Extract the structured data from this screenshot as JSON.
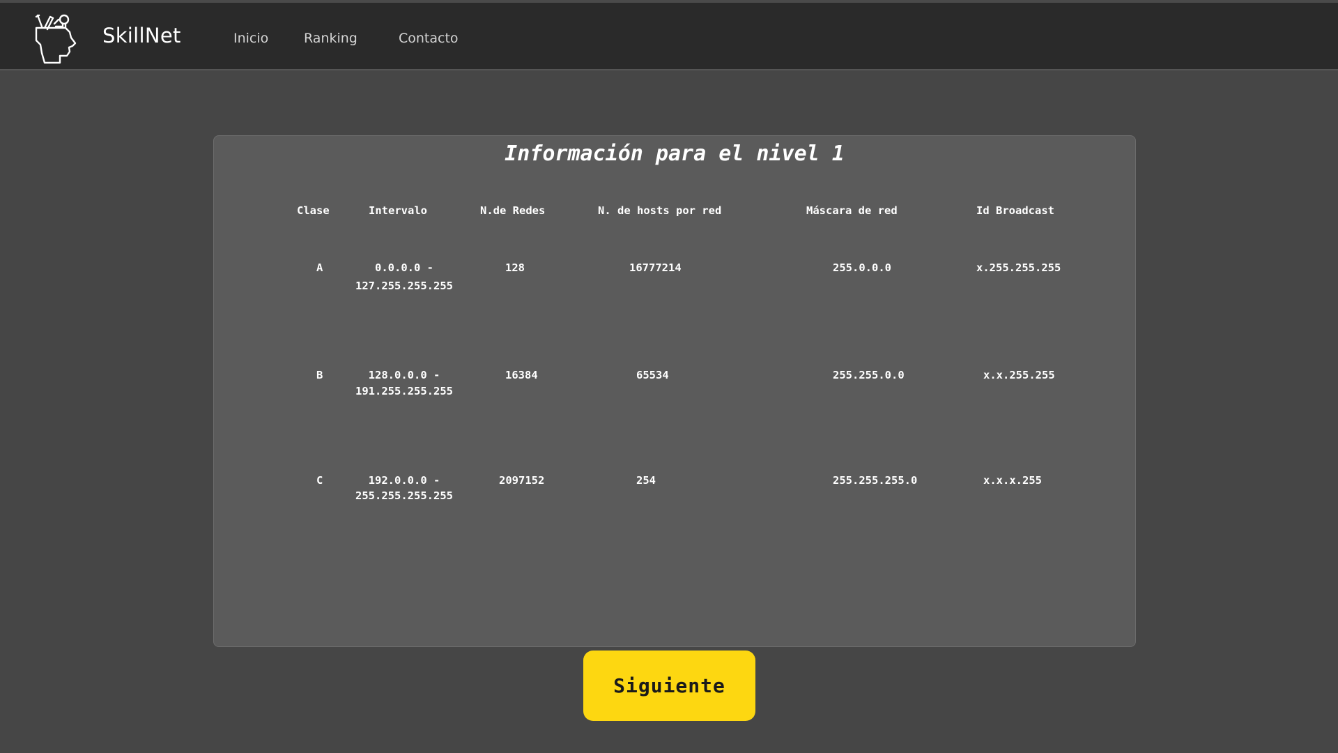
{
  "navbar": {
    "brand": "SkillNet",
    "links": [
      "Inicio",
      "Ranking",
      "Contacto"
    ],
    "logo_icon": "head-with-ideas-icon"
  },
  "card": {
    "title": "Información para el nivel 1",
    "table": {
      "headers": [
        "Clase",
        "Intervalo",
        "N.de Redes",
        "N. de hosts por red",
        "Máscara de red",
        "Id Broadcast"
      ],
      "rows": [
        {
          "clase": "A",
          "intervalo_start": "0.0.0.0 -",
          "intervalo_end": "127.255.255.255",
          "redes": "128",
          "hosts": "16777214",
          "mascara": "255.0.0.0",
          "broadcast": "x.255.255.255"
        },
        {
          "clase": "B",
          "intervalo_start": "128.0.0.0 -",
          "intervalo_end": "191.255.255.255",
          "redes": "16384",
          "hosts": "65534",
          "mascara": "255.255.0.0",
          "broadcast": "x.x.255.255"
        },
        {
          "clase": "C",
          "intervalo_start": "192.0.0.0 -",
          "intervalo_end": "255.255.255.255",
          "redes": "2097152",
          "hosts": "254",
          "mascara": "255.255.255.0",
          "broadcast": "x.x.x.255"
        }
      ]
    }
  },
  "next_button": {
    "label": "Siguiente"
  },
  "colors": {
    "background": "#464646",
    "navbar": "#2a2a2a",
    "card": "#5b5b5b",
    "button": "#fdd711"
  }
}
